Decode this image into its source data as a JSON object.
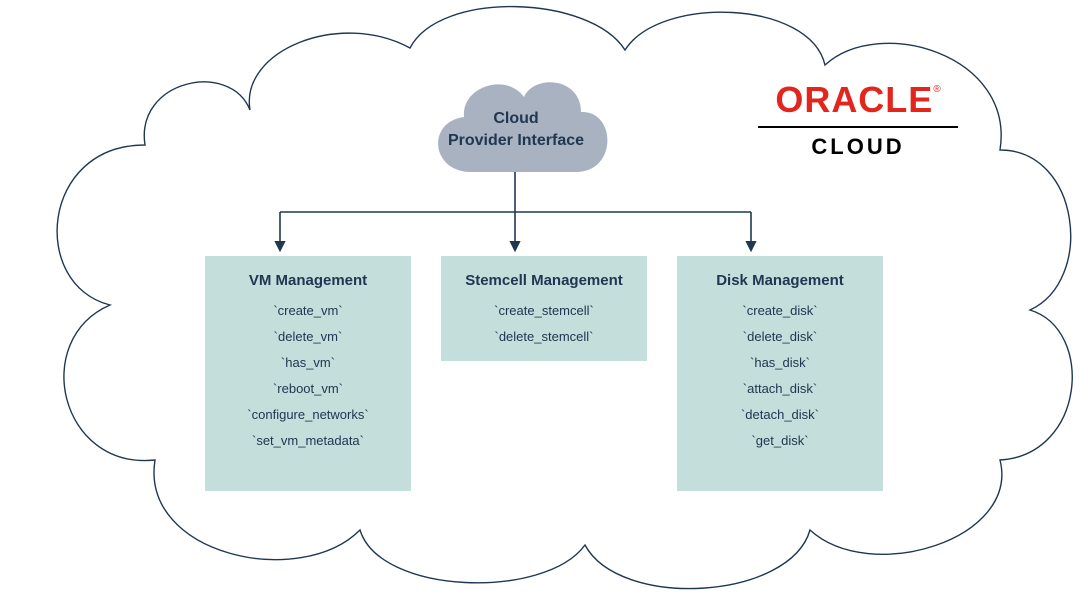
{
  "cpi": {
    "label_line1": "Cloud",
    "label_line2": "Provider Interface"
  },
  "logo": {
    "brand": "ORACLE",
    "reg": "®",
    "sub": "CLOUD"
  },
  "boxes": {
    "vm": {
      "title": "VM Management",
      "items": [
        "`create_vm`",
        "`delete_vm`",
        "`has_vm`",
        "`reboot_vm`",
        "`configure_networks`",
        "`set_vm_metadata`"
      ]
    },
    "stemcell": {
      "title": "Stemcell Management",
      "items": [
        "`create_stemcell`",
        "`delete_stemcell`"
      ]
    },
    "disk": {
      "title": "Disk Management",
      "items": [
        "`create_disk`",
        "`delete_disk`",
        "`has_disk`",
        "`attach_disk`",
        "`detach_disk`",
        "`get_disk`"
      ]
    }
  },
  "colors": {
    "box_bg": "#c3dedb",
    "text": "#203752",
    "oracle_red": "#e2261e",
    "cloud_fill": "#a8b2c0",
    "outline": "#203752"
  }
}
